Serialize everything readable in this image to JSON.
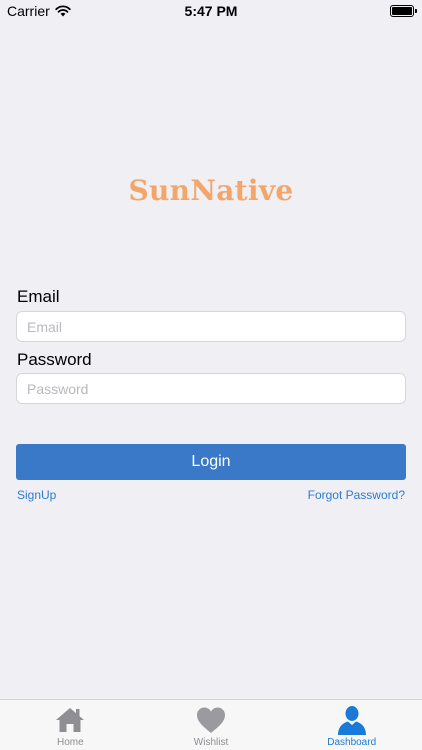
{
  "status_bar": {
    "carrier": "Carrier",
    "time": "5:47 PM",
    "battery_level_percent": 100
  },
  "app": {
    "brand_title": "SunNative",
    "brand_color": "#f4a66a"
  },
  "form": {
    "email_label": "Email",
    "email_placeholder": "Email",
    "email_value": "",
    "password_label": "Password",
    "password_placeholder": "Password",
    "password_value": "",
    "login_label": "Login",
    "login_color": "#3a78c8",
    "signup_link": "SignUp",
    "forgot_link": "Forgot Password?",
    "link_color": "#2f7bd1"
  },
  "tab_bar": {
    "tabs": [
      {
        "label": "Home",
        "icon": "home-icon",
        "active": false
      },
      {
        "label": "Wishlist",
        "icon": "heart-icon",
        "active": false
      },
      {
        "label": "Dashboard",
        "icon": "user-icon",
        "active": true
      }
    ],
    "active_color": "#1a7ad9",
    "inactive_color": "#8e8e93"
  }
}
